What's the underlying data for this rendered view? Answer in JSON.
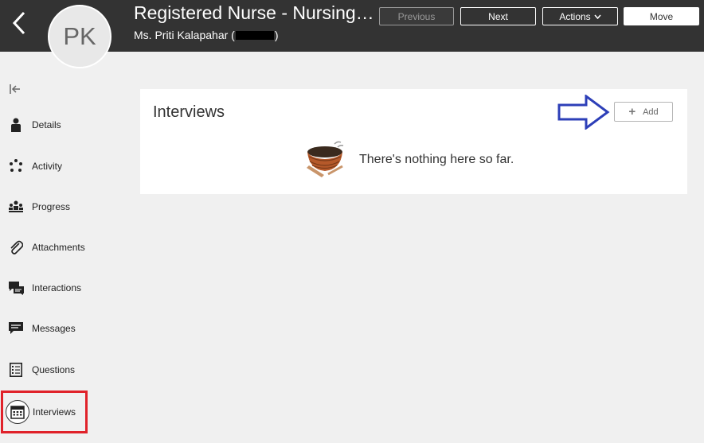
{
  "header": {
    "title": "Registered Nurse - Nursing…",
    "subtitle_prefix": "Ms. Priti Kalapahar (",
    "subtitle_suffix": ")",
    "avatar_initials": "PK",
    "buttons": {
      "previous": "Previous",
      "next": "Next",
      "actions": "Actions",
      "move": "Move"
    }
  },
  "sidebar": {
    "items": [
      {
        "label": "Details",
        "icon": "person-icon"
      },
      {
        "label": "Activity",
        "icon": "activity-icon"
      },
      {
        "label": "Progress",
        "icon": "progress-icon"
      },
      {
        "label": "Attachments",
        "icon": "paperclip-icon"
      },
      {
        "label": "Interactions",
        "icon": "interactions-icon"
      },
      {
        "label": "Messages",
        "icon": "message-icon"
      },
      {
        "label": "Questions",
        "icon": "checklist-icon"
      },
      {
        "label": "Interviews",
        "icon": "calendar-icon",
        "selected": true
      }
    ]
  },
  "main": {
    "section_title": "Interviews",
    "add_label": "Add",
    "empty_message": "There's nothing here so far."
  },
  "colors": {
    "header_bg": "#333333",
    "page_bg": "#f0f0f0",
    "highlight_red": "#e0222a",
    "annotation_blue": "#2d3fb8"
  }
}
